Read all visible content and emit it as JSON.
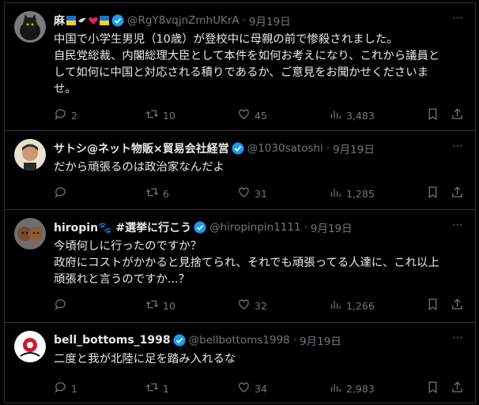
{
  "posts": [
    {
      "name": "麻",
      "handle": "@RgY8vqjnZmhUKrA",
      "date": "9月19日",
      "text": "中国で小学生男児（10歳）が登校中に母親の前で惨殺されました。\n自民党総裁、内閣総理大臣として本件を如何お考えになり、これから議員と\nして如何に中国と対応される積りであるか、ご意見をお聞かせくださいま\nせ。",
      "replies": "2",
      "reposts": "10",
      "likes": "45",
      "views": "3,483"
    },
    {
      "name": "サトシ@ネット物販×貿易会社経営",
      "handle": "@1030satoshi",
      "date": "9月19日",
      "text": "だから頑張るのは政治家なんだよ",
      "replies": "",
      "reposts": "6",
      "likes": "31",
      "views": "1,285"
    },
    {
      "name": "hiropin🐾 #選挙に行こう",
      "handle": "@hiropinpin1111",
      "date": "9月19日",
      "text": "今頃何しに行ったのですか？\n政府にコストがかかると見捨てられ、それでも頑張ってる人達に、これ以上\n頑張れと言うのですか...？",
      "replies": "",
      "reposts": "10",
      "likes": "32",
      "views": "1,266"
    },
    {
      "name": "bell_bottoms_1998",
      "handle": "@bellbottoms1998",
      "date": "9月19日",
      "text": "二度と我が北陸に足を踏み入れるな",
      "replies": "1",
      "reposts": "1",
      "likes": "34",
      "views": "2,983"
    }
  ],
  "more_glyph": "⋯",
  "dot": "·",
  "colors": {
    "bg": "#000000",
    "text": "#e7e9ea",
    "muted": "#71767b",
    "verified": "#1d9bf0",
    "border": "#2f3336"
  }
}
